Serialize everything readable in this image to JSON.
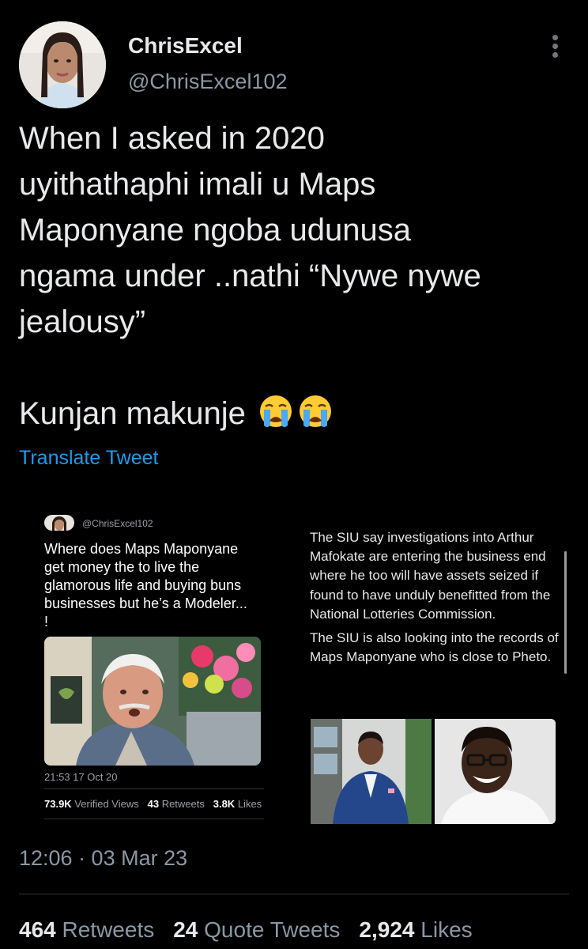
{
  "author": {
    "display_name": "ChrisExcel",
    "handle": "@ChrisExcel102"
  },
  "tweet": {
    "lines": [
      "When I asked in 2020",
      "uyithathaphi imali u Maps",
      "Maponyane ngoba udunusa",
      "ngama under ..nathi “Nywe nywe",
      "jealousy”"
    ],
    "closing": "Kunjan makunje",
    "emoji_icons": [
      "loudly-crying-face-emoji",
      "loudly-crying-face-emoji"
    ],
    "translate_label": "Translate Tweet"
  },
  "media": {
    "embedded_tweet": {
      "handle": "@ChrisExcel102",
      "text": "Where does Maps Maponyane get money the to live the glamorous life and buying buns businesses but he’s a Modeler... !",
      "time": "21:53  17 Oct 20",
      "views_count": "73.9K",
      "views_label": "Verified Views",
      "retweets_count": "43",
      "retweets_label": "Retweets",
      "likes_count": "3.8K",
      "likes_label": "Likes"
    },
    "news": {
      "paragraph1": "The SIU say investigations into Arthur Mafokate are entering the business end where he too will have assets seized if found to have unduly benefitted from the National Lotteries Commission.",
      "paragraph2": "The SIU is also looking into the records of Maps Maponyane who is close to Pheto."
    }
  },
  "footer": {
    "timestamp": "12:06 · 03 Mar 23",
    "retweets_count": "464",
    "retweets_label": "Retweets",
    "quotes_count": "24",
    "quotes_label": "Quote Tweets",
    "likes_count": "2,924",
    "likes_label": "Likes"
  },
  "colors": {
    "background": "#000000",
    "link": "#1d9bf0",
    "secondary_text": "#8b98a5"
  }
}
